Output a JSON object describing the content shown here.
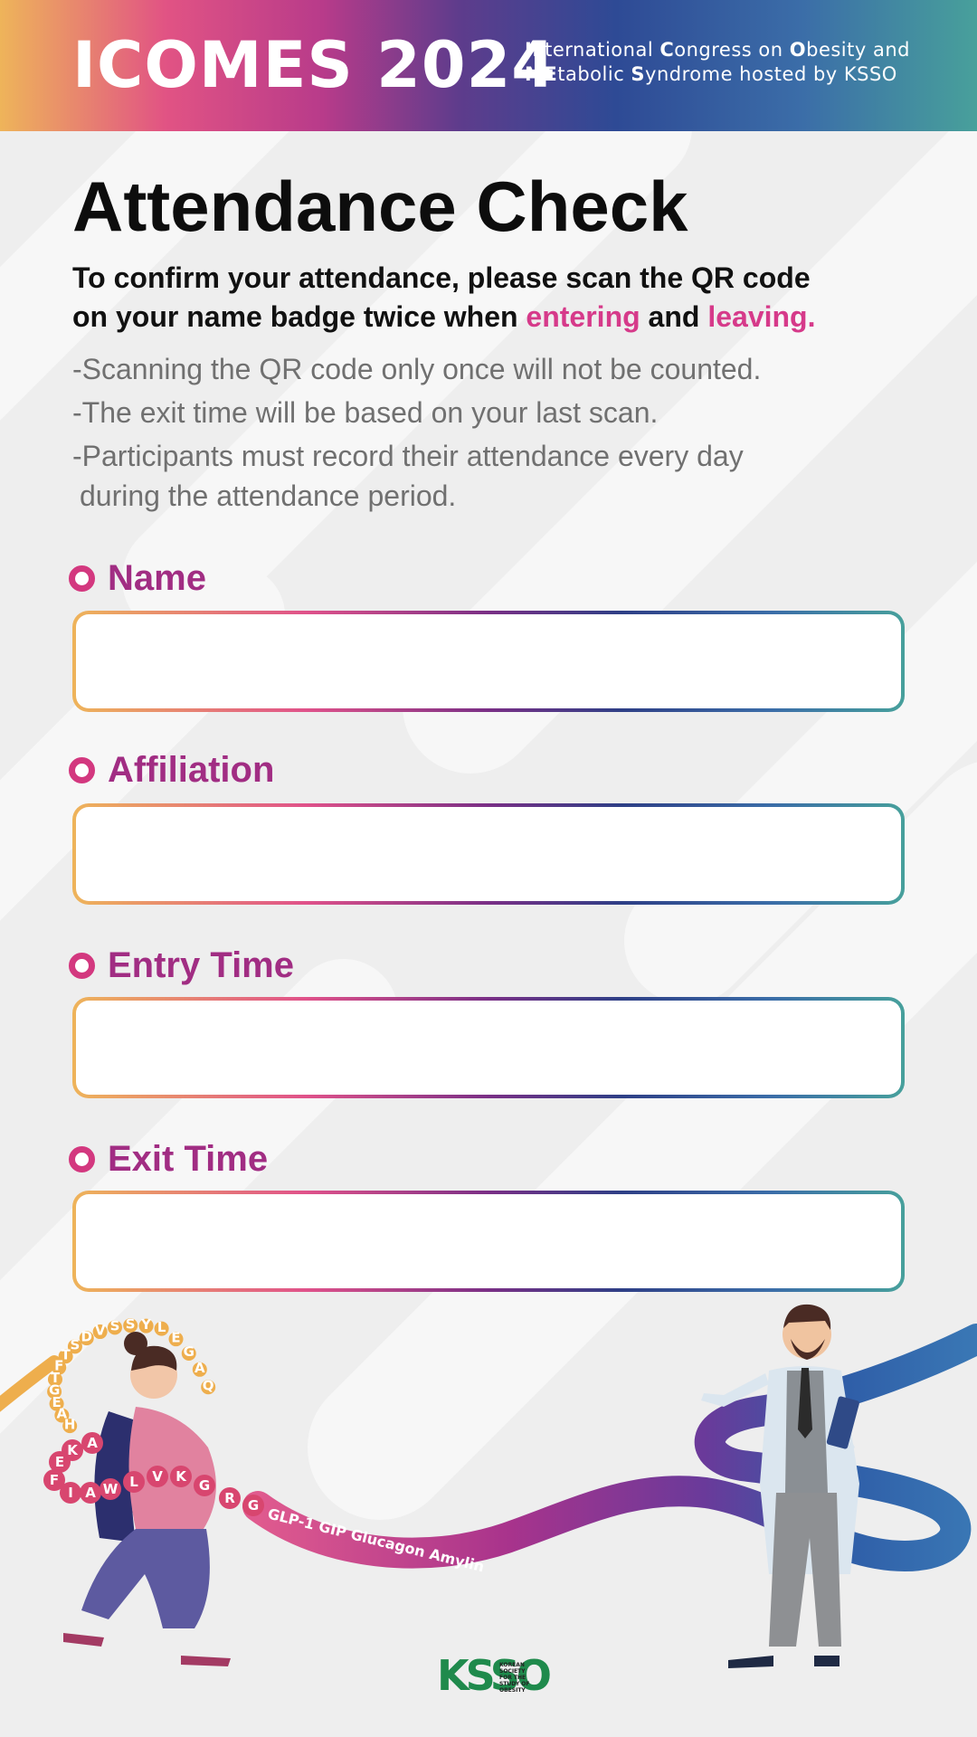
{
  "header": {
    "title": "ICOMES 2024",
    "subtitle_line1": [
      {
        "text": "I",
        "bold": true
      },
      {
        "text": "nternational ",
        "bold": false
      },
      {
        "text": "C",
        "bold": true
      },
      {
        "text": "ongress on ",
        "bold": false
      },
      {
        "text": "O",
        "bold": true
      },
      {
        "text": "besity and",
        "bold": false
      }
    ],
    "subtitle_line2": [
      {
        "text": "ME",
        "bold": true
      },
      {
        "text": "tabolic ",
        "bold": false
      },
      {
        "text": "S",
        "bold": true
      },
      {
        "text": "yndrome hosted by KSSO",
        "bold": false
      }
    ],
    "gradient_colors": [
      "#eeb45a",
      "#e15384",
      "#5e3c8c",
      "#2e4a95",
      "#48a09b"
    ]
  },
  "main": {
    "title": "Attendance Check",
    "instruction_line1": "To confirm your attendance, please scan the QR code",
    "instruction_line2_prefix": "on your name badge twice when ",
    "instruction_entering": "entering",
    "instruction_and": " and ",
    "instruction_leaving": "leaving.",
    "notes": [
      "-Scanning the QR code only once will not be counted.",
      "-The exit time will be based on your last scan.",
      "-Participants must record their attendance every day"
    ],
    "notes_continuation": "during the attendance period."
  },
  "form": {
    "name_label": "Name",
    "name_value": "",
    "affiliation_label": "Affiliation",
    "affiliation_value": "",
    "entry_time_label": "Entry Time",
    "entry_time_value": "",
    "exit_time_label": "Exit Time",
    "exit_time_value": ""
  },
  "illustration": {
    "ribbon_text": "GLP-1 GIP Glucagon Amylin",
    "peptide_letters_red": [
      "E",
      "K",
      "A",
      "F",
      "I",
      "A",
      "W",
      "L",
      "V",
      "K",
      "G",
      "R",
      "G"
    ],
    "peptide_letters_orange": [
      "Q",
      "A",
      "G",
      "E",
      "L",
      "Y",
      "S",
      "S",
      "V",
      "D",
      "S",
      "T",
      "F",
      "T",
      "G",
      "E",
      "A",
      "H"
    ],
    "logo_text": "KSSO",
    "logo_subtext": [
      "KOREAN",
      "SOCIETY",
      "FOR THE",
      "STUDY OF",
      "OBESITY"
    ]
  },
  "colors": {
    "accent_pink": "#d63a8a",
    "label_purple": "#a12d83",
    "bullet_pink": "#d3387f",
    "note_gray": "#707070",
    "logo_green": "#1f8a4c"
  }
}
